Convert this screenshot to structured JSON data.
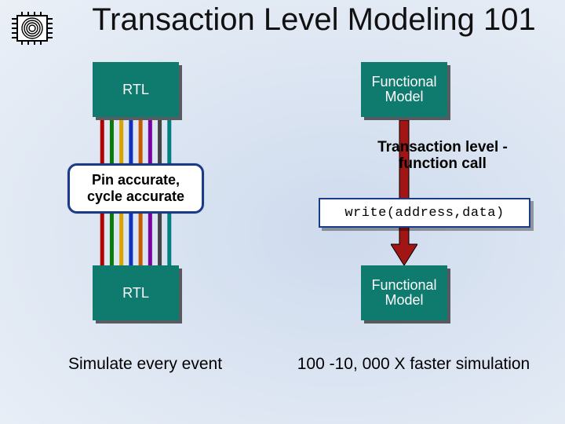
{
  "title": "Transaction Level Modeling 101",
  "left": {
    "top_block": "RTL",
    "annotation": "Pin accurate, cycle accurate",
    "bottom_block": "RTL",
    "caption": "Simulate every event"
  },
  "right": {
    "top_block": "Functional Model",
    "annotation": "Transaction level - function call",
    "code": "write(address,data)",
    "bottom_block": "Functional Model",
    "caption": "100 -10, 000 X faster simulation"
  },
  "wire_colors": [
    "#b00000",
    "#0a7a0a",
    "#d9a400",
    "#1030c0",
    "#c75a00",
    "#7a00a0",
    "#444444",
    "#008080"
  ],
  "colors": {
    "block_fill": "#0f7a6e",
    "annotation_border": "#1a3a8a",
    "tx_arrow_fill": "#a11515",
    "tx_arrow_stroke": "#000"
  }
}
